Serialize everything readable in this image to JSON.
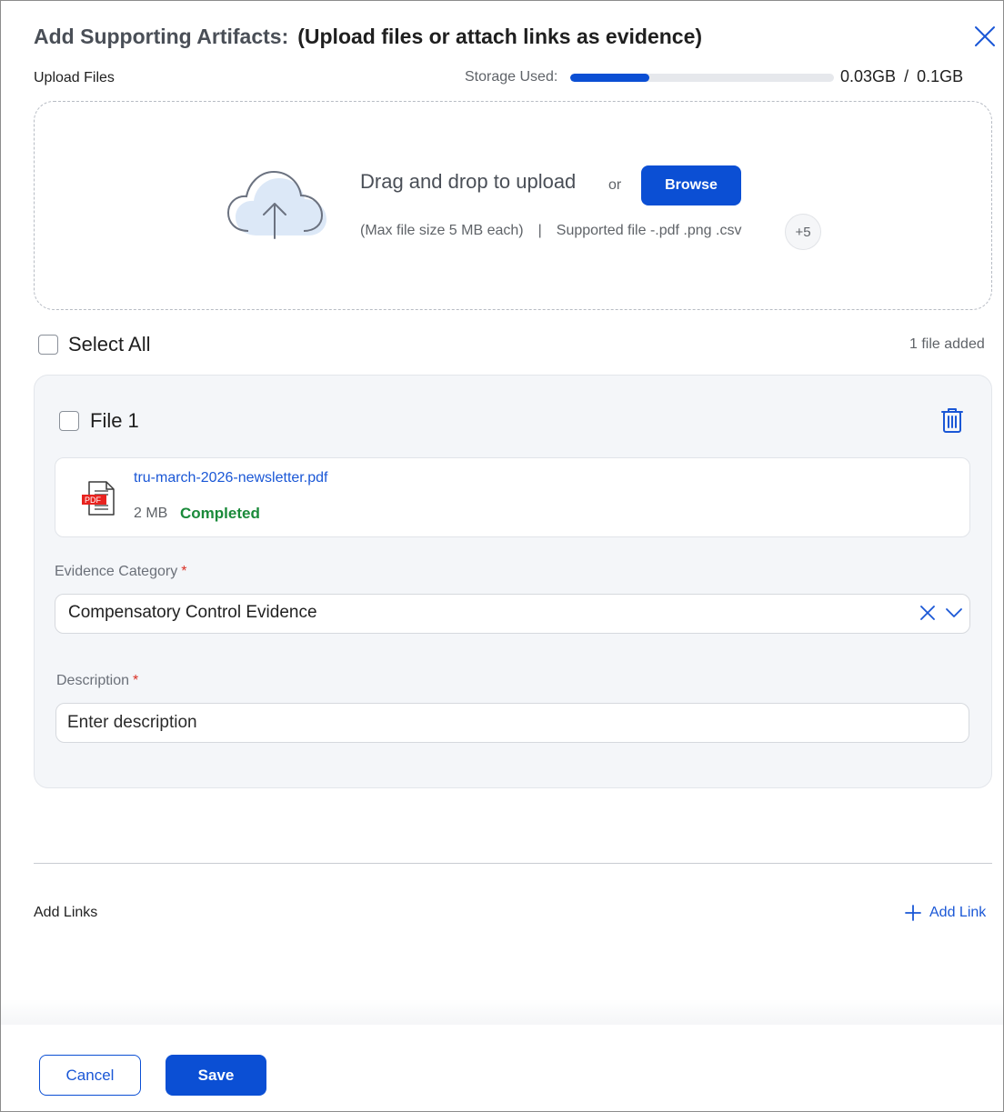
{
  "header": {
    "title": "Add Supporting Artifacts:",
    "subtitle": "(Upload files or attach links as evidence)"
  },
  "upload": {
    "section_label": "Upload Files",
    "storage_label": "Storage Used:",
    "storage_used": "0.03GB",
    "storage_sep": "/",
    "storage_total": "0.1GB",
    "storage_fraction": 0.3,
    "drag_text": "Drag and drop to upload",
    "or_text": "or",
    "browse_label": "Browse",
    "max_size_text": "(Max file size 5 MB each)",
    "separator": "|",
    "supported_text": "Supported file -.pdf .png .csv",
    "more_badge": "+5"
  },
  "selection": {
    "select_all_label": "Select All",
    "file_count": "1 file added"
  },
  "file_card": {
    "title": "File 1",
    "file_name": "tru-march-2026-newsletter.pdf",
    "file_size": "2 MB",
    "status": "Completed",
    "pdf_badge": "PDF",
    "category_label": "Evidence Category",
    "category_value": "Compensatory Control Evidence",
    "description_label": "Description",
    "description_placeholder": "Enter description",
    "required_mark": "*"
  },
  "links": {
    "section_label": "Add Links",
    "add_link_label": "Add Link"
  },
  "footer": {
    "cancel_label": "Cancel",
    "save_label": "Save"
  },
  "colors": {
    "primary": "#0b4fd4",
    "link": "#1a57d6",
    "success": "#1a8a3a",
    "required": "#d93025",
    "card_bg": "#f4f6f9"
  },
  "icons": [
    "close-icon",
    "cloud-upload-icon",
    "trash-icon",
    "pdf-file-icon",
    "clear-icon",
    "chevron-down-icon",
    "plus-icon"
  ]
}
